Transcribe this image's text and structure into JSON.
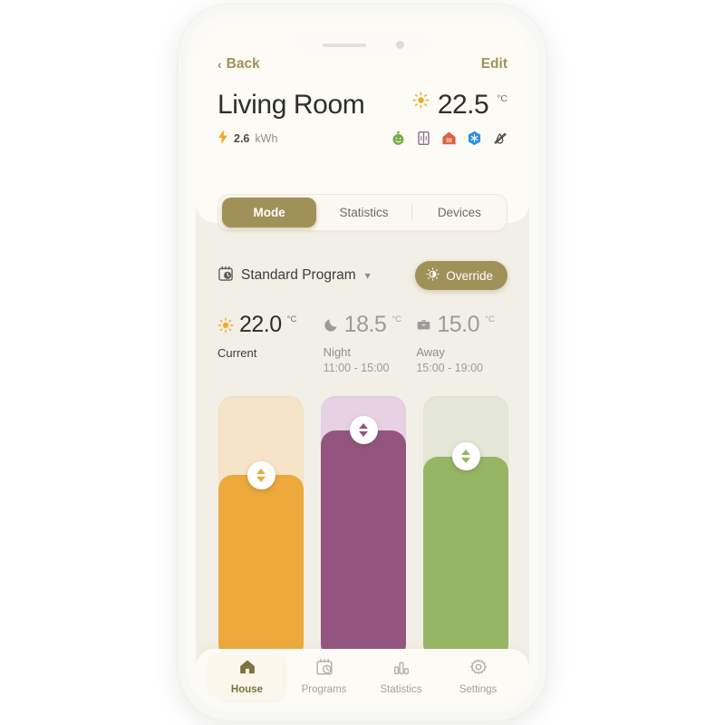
{
  "theme": {
    "accent": "#a09159",
    "page_bg": "#f2efe7",
    "card_bg": "#fdfbf5",
    "slider_orange": "#eda93c",
    "slider_orange_track": "#f5e4c8",
    "slider_purple": "#93557f",
    "slider_purple_track": "#e7d2e4",
    "slider_green": "#97b665",
    "slider_green_track": "#e4e7d7"
  },
  "header": {
    "back_label": "Back",
    "edit_label": "Edit",
    "room_title": "Living Room",
    "current_temp": "22.5",
    "degree_unit": "°C",
    "energy_value": "2.6",
    "energy_unit": "kWh",
    "status_icons": [
      {
        "name": "air-quality-icon",
        "color": "#7aab44"
      },
      {
        "name": "window-icon",
        "color": "#8e6f92"
      },
      {
        "name": "heating-house-icon",
        "color": "#e2603f"
      },
      {
        "name": "cooling-snowflake-icon",
        "color": "#2f8fdc"
      },
      {
        "name": "humidity-off-icon",
        "color": "#3a3a3a"
      }
    ]
  },
  "tabs": {
    "items": [
      {
        "label": "Mode",
        "active": true
      },
      {
        "label": "Statistics",
        "active": false
      },
      {
        "label": "Devices",
        "active": false
      }
    ]
  },
  "program": {
    "name": "Standard Program",
    "override_label": "Override"
  },
  "presets": [
    {
      "value": "22.0",
      "unit": "°C",
      "label": "Current",
      "time": "",
      "icon": "sun-icon",
      "state": "active"
    },
    {
      "value": "18.5",
      "unit": "°C",
      "label": "Night",
      "time": "11:00 - 15:00",
      "icon": "moon-icon",
      "state": "dim"
    },
    {
      "value": "15.0",
      "unit": "°C",
      "label": "Away",
      "time": "15:00 - 19:00",
      "icon": "briefcase-icon",
      "state": "dim"
    }
  ],
  "sliders": [
    {
      "name": "slider-current",
      "fill_percent": 70,
      "handle_percent": 70,
      "fill_color": "#eda93c",
      "track_color": "#f5e4c8"
    },
    {
      "name": "slider-night",
      "fill_percent": 87,
      "handle_percent": 87,
      "fill_color": "#93557f",
      "track_color": "#e7d2e4"
    },
    {
      "name": "slider-away",
      "fill_percent": 77,
      "handle_percent": 77,
      "fill_color": "#97b665",
      "track_color": "#e4e7d7"
    }
  ],
  "bottom_nav": {
    "items": [
      {
        "label": "House",
        "icon": "home-icon",
        "active": true
      },
      {
        "label": "Programs",
        "icon": "calendar-clock-icon",
        "active": false
      },
      {
        "label": "Statistics",
        "icon": "bar-chart-icon",
        "active": false
      },
      {
        "label": "Settings",
        "icon": "gear-icon",
        "active": false
      }
    ]
  }
}
